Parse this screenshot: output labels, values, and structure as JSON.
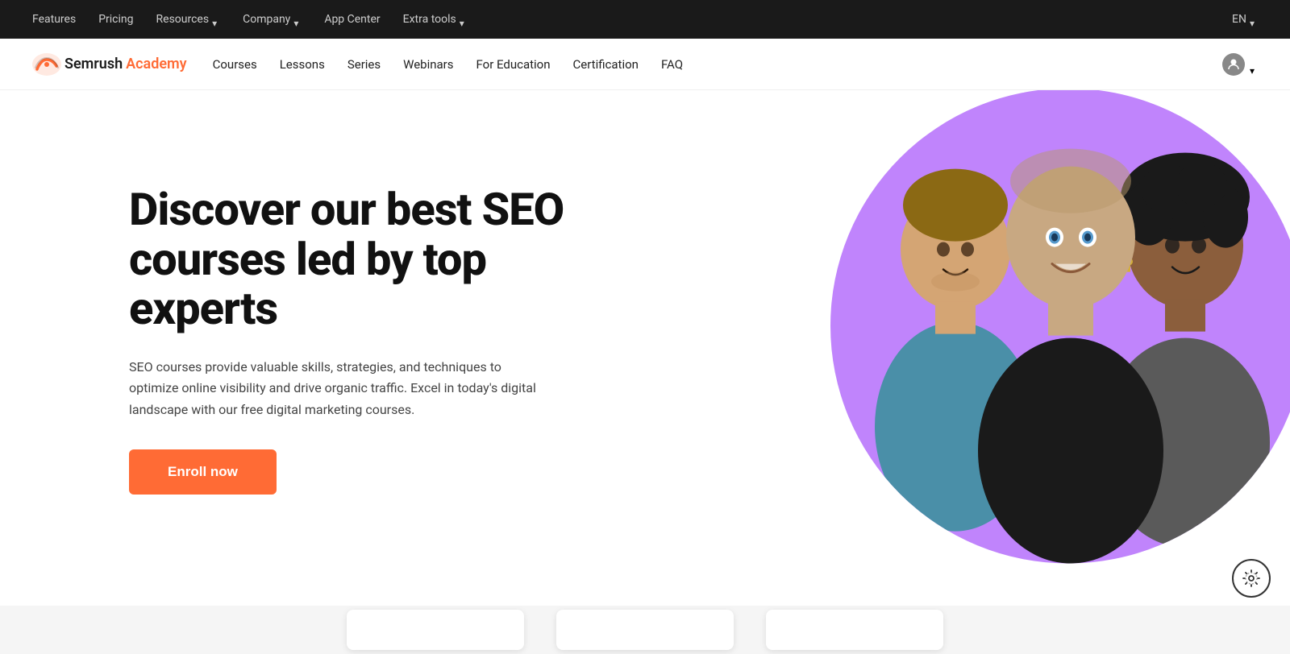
{
  "topbar": {
    "nav_items": [
      {
        "label": "Features",
        "has_dropdown": false
      },
      {
        "label": "Pricing",
        "has_dropdown": false
      },
      {
        "label": "Resources",
        "has_dropdown": true
      },
      {
        "label": "Company",
        "has_dropdown": true
      },
      {
        "label": "App Center",
        "has_dropdown": false
      },
      {
        "label": "Extra tools",
        "has_dropdown": true
      }
    ],
    "lang": "EN"
  },
  "mainnav": {
    "logo_brand": "Semrush",
    "logo_academy": "Academy",
    "items": [
      {
        "label": "Courses"
      },
      {
        "label": "Lessons"
      },
      {
        "label": "Series"
      },
      {
        "label": "Webinars"
      },
      {
        "label": "For Education"
      },
      {
        "label": "Certification"
      },
      {
        "label": "FAQ"
      }
    ]
  },
  "hero": {
    "title": "Discover our best SEO courses led by top experts",
    "description": "SEO courses provide valuable skills, strategies, and techniques to optimize online visibility and drive organic traffic. Excel in today's digital landscape with our free digital marketing courses.",
    "cta_label": "Enroll now",
    "image_bg_color": "#c084fc"
  },
  "settings": {
    "icon_label": "⚙"
  }
}
